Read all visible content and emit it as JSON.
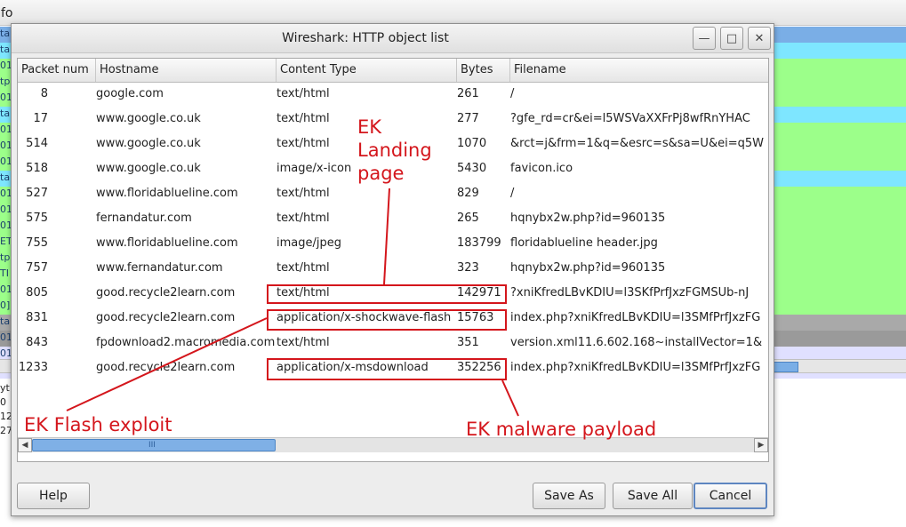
{
  "background_window": {
    "title_fragment": "fo",
    "row_colors": [
      "#7aaee6",
      "#7ee6ff",
      "#9cff8a",
      "#9cff8a",
      "#9cff8a",
      "#7ee6ff",
      "#9cff8a",
      "#9cff8a",
      "#9cff8a",
      "#7ee6ff",
      "#9cff8a",
      "#9cff8a",
      "#9cff8a",
      "#9cff8a",
      "#9cff8a",
      "#9cff8a",
      "#9cff8a",
      "#9cff8a",
      "#a9a9a9",
      "#9a9a9a",
      "#e0e0ff",
      "#e0e0ff"
    ],
    "row_texts": [
      "ta",
      "ta",
      "01",
      "tp",
      "01",
      "ta",
      "01",
      "01",
      "01",
      "ta",
      "01",
      "01",
      "01",
      "ET",
      "tp",
      "TI",
      "01",
      "0]",
      "ta",
      "01",
      "01",
      "i"
    ],
    "details": [
      "yt",
      "0",
      "12",
      "27"
    ]
  },
  "dialog": {
    "title": "Wireshark: HTTP object list",
    "window_buttons": {
      "minimize": "—",
      "maximize": "□",
      "close": "✕"
    },
    "columns": [
      "Packet num",
      "Hostname",
      "Content Type",
      "Bytes",
      "Filename"
    ],
    "rows": [
      {
        "packet": "8",
        "host": "google.com",
        "type": "text/html",
        "bytes": "261",
        "file": "/"
      },
      {
        "packet": "17",
        "host": "www.google.co.uk",
        "type": "text/html",
        "bytes": "277",
        "file": "?gfe_rd=cr&ei=l5WSVaXXFrPj8wfRnYHAC"
      },
      {
        "packet": "514",
        "host": "www.google.co.uk",
        "type": "text/html",
        "bytes": "1070",
        "file": "&rct=j&frm=1&q=&esrc=s&sa=U&ei=q5W"
      },
      {
        "packet": "518",
        "host": "www.google.co.uk",
        "type": "image/x-icon",
        "bytes": "5430",
        "file": "favicon.ico"
      },
      {
        "packet": "527",
        "host": "www.floridablueline.com",
        "type": "text/html",
        "bytes": "829",
        "file": "/"
      },
      {
        "packet": "575",
        "host": "fernandatur.com",
        "type": "text/html",
        "bytes": "265",
        "file": "hqnybx2w.php?id=960135"
      },
      {
        "packet": "755",
        "host": "www.floridablueline.com",
        "type": "image/jpeg",
        "bytes": "183799",
        "file": "floridablueline header.jpg"
      },
      {
        "packet": "757",
        "host": "www.fernandatur.com",
        "type": "text/html",
        "bytes": "323",
        "file": "hqnybx2w.php?id=960135"
      },
      {
        "packet": "805",
        "host": "good.recycle2learn.com",
        "type": "text/html",
        "bytes": "142971",
        "file": "?xniKfredLBvKDIU=l3SKfPrfJxzFGMSUb-nJ"
      },
      {
        "packet": "831",
        "host": "good.recycle2learn.com",
        "type": "application/x-shockwave-flash",
        "bytes": "15763",
        "file": "index.php?xniKfredLBvKDIU=l3SMfPrfJxzFG"
      },
      {
        "packet": "843",
        "host": "fpdownload2.macromedia.com",
        "type": "text/html",
        "bytes": "351",
        "file": "version.xml11.6.602.168~installVector=1&"
      },
      {
        "packet": "1233",
        "host": "good.recycle2learn.com",
        "type": "application/x-msdownload",
        "bytes": "352256",
        "file": "index.php?xniKfredLBvKDIU=l3SMfPrfJxzFG"
      }
    ],
    "scroll_grip": "III",
    "buttons": {
      "help": "Help",
      "save_as": "Save As",
      "save_all": "Save All",
      "cancel": "Cancel"
    }
  },
  "annotations": {
    "landing": [
      "EK",
      "Landing",
      "page"
    ],
    "flash": "EK Flash exploit",
    "payload": "EK malware payload",
    "color": "#d4161c"
  }
}
